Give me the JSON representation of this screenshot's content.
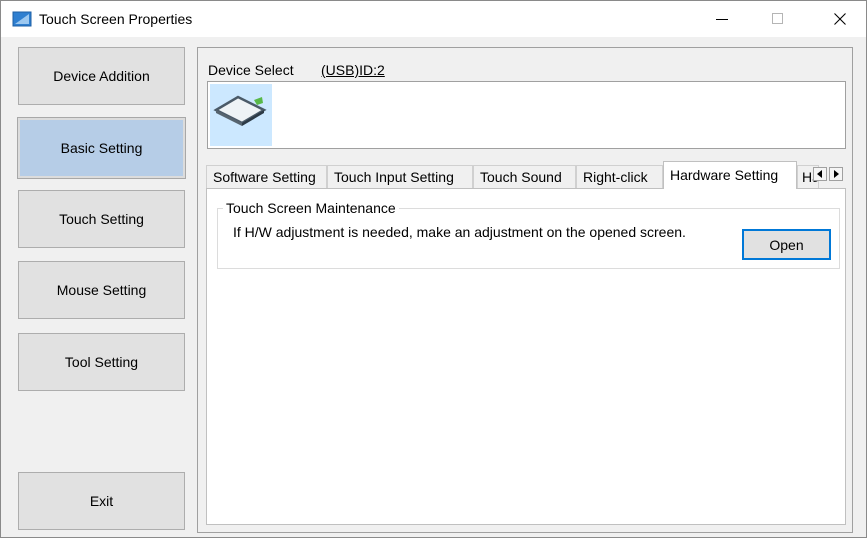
{
  "window": {
    "title": "Touch Screen Properties"
  },
  "sidebar": {
    "items": [
      {
        "label": "Device Addition"
      },
      {
        "label": "Basic Setting"
      },
      {
        "label": "Touch Setting"
      },
      {
        "label": "Mouse Setting"
      },
      {
        "label": "Tool Setting"
      }
    ],
    "exit_label": "Exit"
  },
  "device": {
    "select_label": "Device Select",
    "selected_id": "(USB)ID:2"
  },
  "tabs": [
    {
      "label": "Software Setting"
    },
    {
      "label": "Touch Input Setting"
    },
    {
      "label": "Touch Sound"
    },
    {
      "label": "Right-click"
    },
    {
      "label": "Hardware Setting"
    },
    {
      "label": "Ha"
    }
  ],
  "hardware": {
    "group_title": "Touch Screen Maintenance",
    "message": "If H/W adjustment is needed, make an adjustment on the opened screen.",
    "open_label": "Open"
  },
  "colors": {
    "active_item": "#b6cde7",
    "accent": "#0078d7"
  }
}
